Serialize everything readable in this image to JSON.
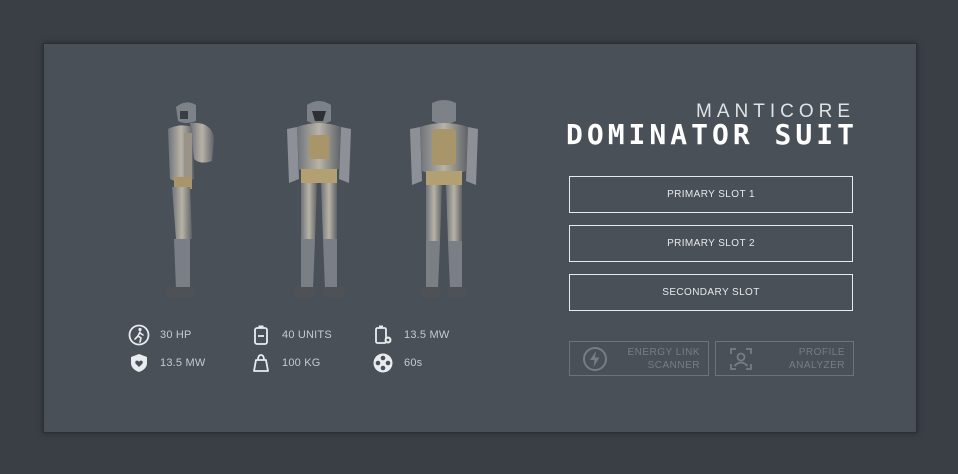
{
  "header": {
    "brand": "MANTICORE",
    "title": "DOMINATOR SUIT"
  },
  "suit_views": [
    {
      "icon": "suit-side-view"
    },
    {
      "icon": "suit-front-view"
    },
    {
      "icon": "suit-back-view"
    }
  ],
  "stats": [
    {
      "icon": "walking-figure-icon",
      "value": "30 HP"
    },
    {
      "icon": "shield-heart-icon",
      "value": "13.5 MW"
    },
    {
      "icon": "battery-pack-icon",
      "value": "40 UNITS"
    },
    {
      "icon": "weight-icon",
      "value": "100 KG"
    },
    {
      "icon": "battery-gear-icon",
      "value": "13.5 MW"
    },
    {
      "icon": "reel-timer-icon",
      "value": "60s"
    }
  ],
  "slots": [
    {
      "label": "PRIMARY SLOT 1"
    },
    {
      "label": "PRIMARY SLOT 2"
    },
    {
      "label": "SECONDARY SLOT"
    }
  ],
  "tools": [
    {
      "icon": "lightning-icon",
      "line1": "ENERGY LINK",
      "line2": "SCANNER"
    },
    {
      "icon": "profile-scan-icon",
      "line1": "PROFILE",
      "line2": "ANALYZER"
    }
  ],
  "colors": {
    "background": "#3a3f45",
    "panel": "#4a5057",
    "armor_gold": "#a8956a",
    "armor_grey": "#8a8f96"
  }
}
